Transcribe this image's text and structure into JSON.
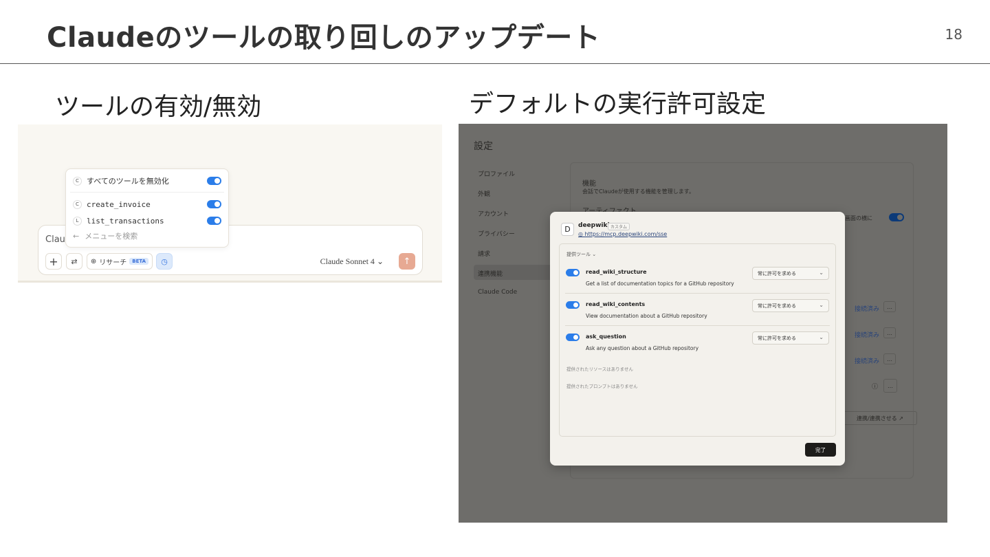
{
  "slide": {
    "title": "Claudeのツールの取り回しのアップデート",
    "page_number": "18"
  },
  "left": {
    "heading": "ツールの有効/無効",
    "menu": {
      "items": [
        {
          "badge": "C",
          "label": "すべてのツールを無効化",
          "toggle_on": true
        },
        {
          "badge": "C",
          "label": "create_invoice",
          "toggle_on": true
        },
        {
          "badge": "L",
          "label": "list_transactions",
          "toggle_on": true
        }
      ],
      "search_arrow": "←",
      "search_placeholder": "メニューを検索"
    },
    "composer": {
      "text": "Clauc",
      "plus": "+",
      "tune": "⇄",
      "research_icon": "⊕",
      "research_label": "リサーチ",
      "beta": "BETA",
      "clock": "◷",
      "model": "Claude Sonnet 4",
      "model_chevron": "⌄",
      "send": "↑"
    }
  },
  "right": {
    "heading": "デフォルトの実行許可設定",
    "settings": {
      "title": "設定",
      "nav": [
        "プロファイル",
        "外観",
        "アカウント",
        "プライバシー",
        "請求",
        "連携機能",
        "Claude Code"
      ],
      "active_nav": "連携機能",
      "features_title": "機能",
      "features_desc": "会話でClaudeが使用する機能を管理します。",
      "artifact_label": "アーティファクト",
      "side_label": "画面の横に",
      "connected": "接続済み",
      "dots": "…",
      "info": "ⓘ",
      "connect_btn": "連携/連携させる ↗"
    },
    "modal": {
      "logo": "D",
      "name": "deepwiki",
      "custom_badge": "カスタム",
      "url": "https://mcp.deepwiki.com/sse",
      "url_icon": "◎",
      "tools_label": "提供ツール ⌄",
      "tools": [
        {
          "name": "read_wiki_structure",
          "desc": "Get a list of documentation topics for a GitHub repository",
          "permission": "常に許可を求める",
          "enabled": true
        },
        {
          "name": "read_wiki_contents",
          "desc": "View documentation about a GitHub repository",
          "permission": "常に許可を求める",
          "enabled": true
        },
        {
          "name": "ask_question",
          "desc": "Ask any question about a GitHub repository",
          "permission": "常に許可を求める",
          "enabled": true
        }
      ],
      "select_chevron": "⌄",
      "no_resources": "提供されたリソースはありません",
      "no_prompts": "提供されたプロンプトはありません",
      "done": "完了"
    }
  }
}
